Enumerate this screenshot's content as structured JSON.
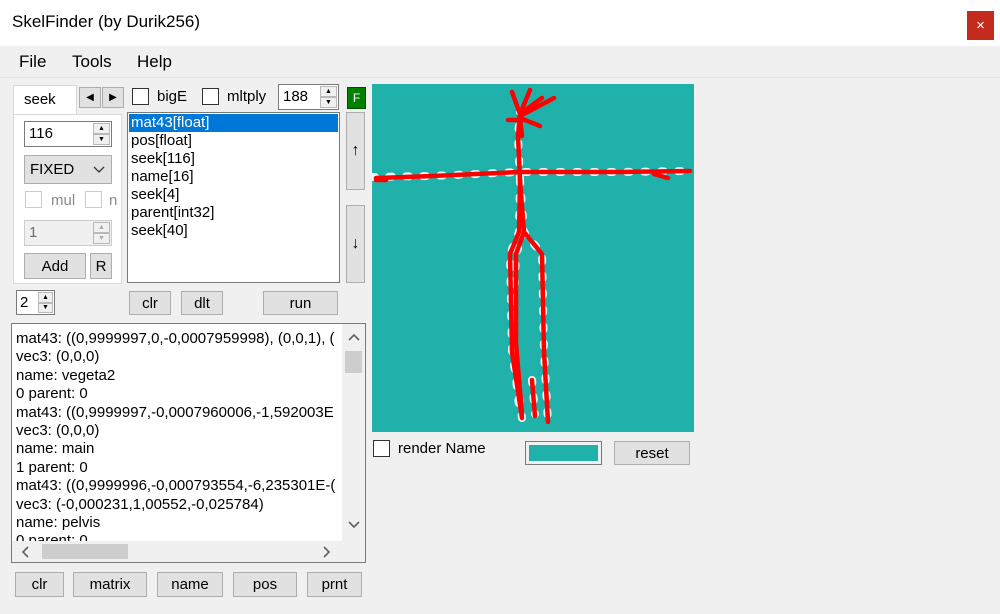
{
  "window": {
    "title": "SkelFinder (by Durik256)",
    "close_glyph": "×"
  },
  "menu": [
    "File",
    "Tools",
    "Help"
  ],
  "left_panel": {
    "tab_label": "seek",
    "seek_value": "116",
    "type_select": "FIXED",
    "mul_label": "mul",
    "n_label": "n",
    "count_value": "1",
    "add_label": "Add",
    "r_label": "R",
    "small_spin_value": "2"
  },
  "options": {
    "bigE_label": "bigE",
    "mltply_label": "mltply",
    "mltply_value": "188",
    "f_label": "F"
  },
  "struct_list": [
    "mat43[float]",
    "pos[float]",
    "seek[116]",
    "name[16]",
    "seek[4]",
    "parent[int32]",
    "seek[40]"
  ],
  "side_buttons": {
    "up": "↑",
    "down": "↓"
  },
  "list_buttons": {
    "clr": "clr",
    "dlt": "dlt",
    "run": "run"
  },
  "output_lines": [
    "mat43: ((0,9999997,0,-0,0007959998), (0,0,1), (",
    "vec3: (0,0,0)",
    "name: vegeta2",
    "0 parent: 0",
    "mat43: ((0,9999997,-0,0007960006,-1,592003E",
    "vec3: (0,0,0)",
    "name: main",
    "1 parent: 0",
    "mat43: ((0,9999996,-0,000793554,-6,235301E-(",
    "vec3: (-0,000231,1,00552,-0,025784)",
    "name: pelvis",
    "0 parent: 0"
  ],
  "bottom_buttons": {
    "clr": "clr",
    "matrix": "matrix",
    "name": "name",
    "pos": "pos",
    "prnt": "prnt"
  },
  "preview": {
    "render_name_label": "render Name",
    "reset_label": "reset",
    "bg_color": "#20b2aa",
    "line_color": "#ff0000"
  }
}
